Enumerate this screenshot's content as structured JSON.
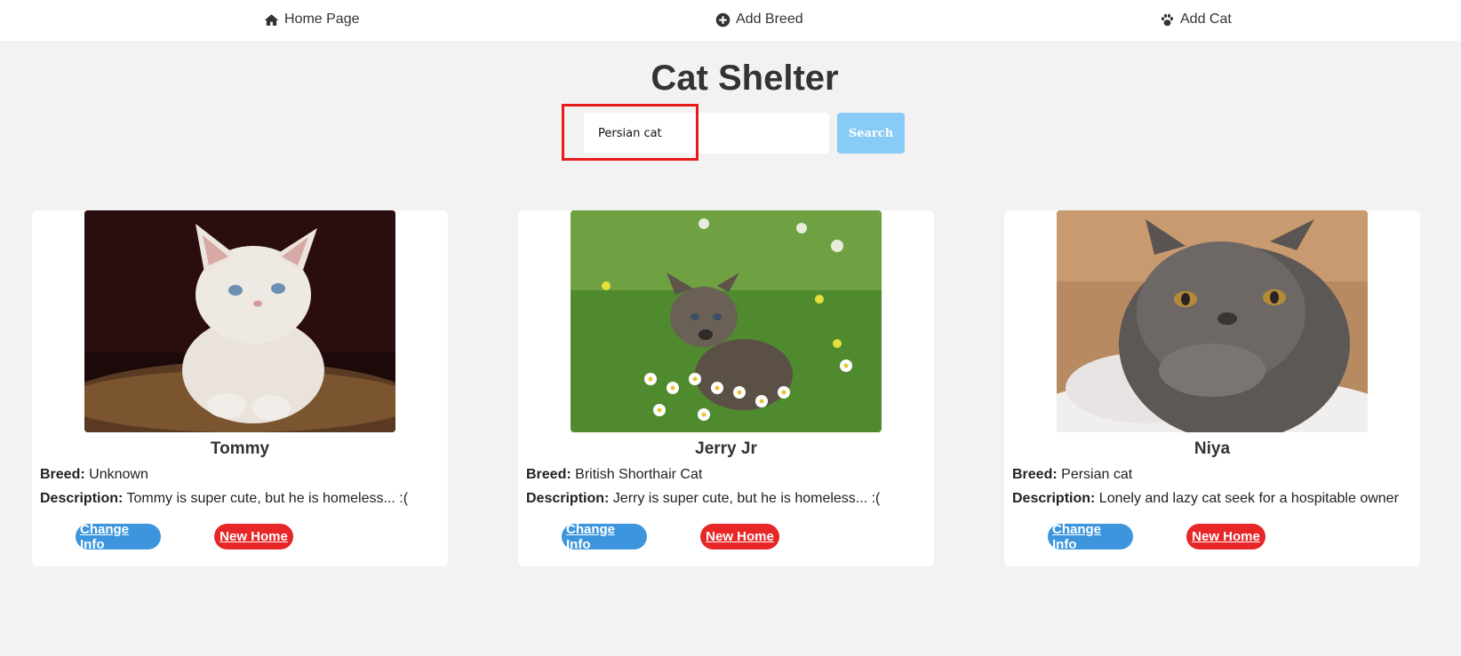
{
  "nav": {
    "home": {
      "label": "Home Page",
      "icon": "home-icon"
    },
    "add_breed": {
      "label": "Add Breed",
      "icon": "plus-circle-icon"
    },
    "add_cat": {
      "label": "Add Cat",
      "icon": "paw-icon"
    }
  },
  "page": {
    "title": "Cat Shelter"
  },
  "search": {
    "value": "Persian cat",
    "button_label": "Search"
  },
  "labels": {
    "breed": "Breed:",
    "description": "Description:"
  },
  "cats": [
    {
      "name": "Tommy",
      "breed": "Unknown",
      "description": "Tommy is super cute, but he is homeless... :(",
      "change_label": "Change Info",
      "new_home_label": "New Home"
    },
    {
      "name": "Jerry Jr",
      "breed": "British Shorthair Cat",
      "description": "Jerry is super cute, but he is homeless... :(",
      "change_label": "Change Info",
      "new_home_label": "New Home"
    },
    {
      "name": "Niya",
      "breed": "Persian cat",
      "description": "Lonely and lazy cat seek for a hospitable owner",
      "change_label": "Change Info",
      "new_home_label": "New Home"
    }
  ],
  "colors": {
    "background": "#f2f2f2",
    "change_button": "#3d96dd",
    "new_home_button": "#e62627",
    "search_button": "#87cbf6",
    "highlight": "#e81a1a"
  }
}
